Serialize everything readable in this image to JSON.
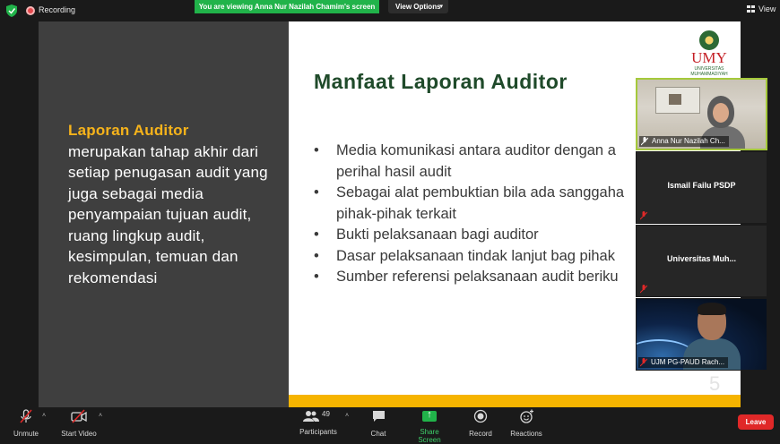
{
  "top_bar": {
    "recording_label": "Recording",
    "viewing_banner": "You are viewing Anna Nur Nazilah Chamim's screen",
    "view_options_label": "View Options",
    "view_label": "View"
  },
  "slide": {
    "left_highlight": "Laporan Auditor",
    "left_body": "merupakan tahap akhir dari setiap penugasan audit yang juga sebagai media penyampaian tujuan audit, ruang lingkup audit, kesimpulan, temuan dan rekomendasi",
    "title": "Manfaat Laporan Auditor",
    "bullets": [
      "Media komunikasi antara auditor dengan a",
      "perihal hasil audit",
      "Sebagai alat pembuktian bila ada sanggaha",
      "pihak-pihak terkait",
      "Bukti pelaksanaan bagi auditor",
      "Dasar pelaksanaan tindak lanjut bag pihak",
      "Sumber referensi pelaksanaan audit beriku"
    ],
    "bullet_has_marker": [
      true,
      false,
      true,
      false,
      true,
      true,
      true
    ],
    "logo_text": "UMY",
    "logo_sub": "UNIVERSITAS MUHAMMADIYAH",
    "page_number": "5",
    "accent_color": "#f6b400",
    "title_color": "#1f4a2a"
  },
  "participants_panel": {
    "tiles": [
      {
        "name": "Anna Nur Nazilah Ch...",
        "has_video": true,
        "active": true
      },
      {
        "name": "Ismail Failu PSDP",
        "has_video": false,
        "active": false
      },
      {
        "name": "Universitas  Muh...",
        "has_video": false,
        "active": false
      },
      {
        "name": "UJM PG-PAUD Rach...",
        "has_video": true,
        "active": false
      }
    ]
  },
  "toolbar": {
    "unmute_label": "Unmute",
    "start_video_label": "Start Video",
    "participants_label": "Participants",
    "participants_count": "49",
    "chat_label": "Chat",
    "share_screen_label": "Share Screen",
    "record_label": "Record",
    "reactions_label": "Reactions",
    "leave_label": "Leave"
  }
}
